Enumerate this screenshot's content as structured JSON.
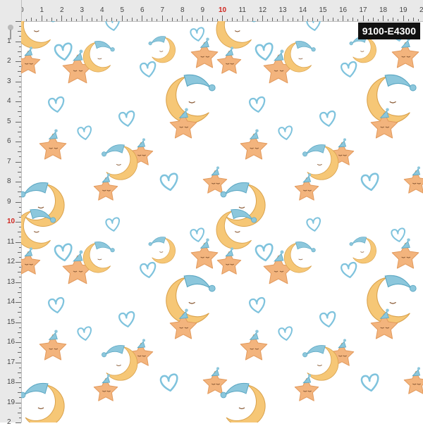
{
  "product": {
    "code": "9100-E4300"
  },
  "ruler": {
    "top_labels": [
      "0",
      "1",
      "2",
      "3",
      "4",
      "5",
      "6",
      "7",
      "8",
      "9",
      "10",
      "11",
      "12",
      "13",
      "14",
      "15",
      "16",
      "17",
      "18",
      "19",
      "20"
    ],
    "left_labels": [
      "1",
      "2",
      "3",
      "4",
      "5",
      "6",
      "7",
      "8",
      "9",
      "10",
      "11",
      "12",
      "13",
      "14",
      "15",
      "16",
      "17",
      "18",
      "19",
      "2"
    ],
    "highlight_label": "10",
    "highlight_color": "#d0261f"
  },
  "pattern": {
    "motifs": [
      "sleepy-moon-icon",
      "sleepy-star-icon",
      "heart-icon"
    ],
    "colors": {
      "moon": "#f6c776",
      "star": "#f3b47d",
      "cap": "#8cc7dc",
      "heart": "#7fc3dd",
      "background": "#ffffff"
    }
  }
}
